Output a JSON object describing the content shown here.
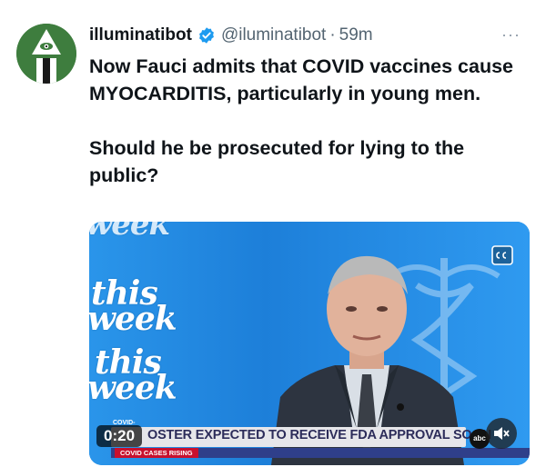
{
  "tweet": {
    "author": {
      "name": "illuminatibot",
      "handle": "@iluminatibot",
      "verified": true,
      "avatar_icon": "eye-pyramid-avatar-icon"
    },
    "separator": "·",
    "time": "59m",
    "more_label": "···",
    "paragraphs": [
      "Now Fauci admits that COVID vaccines cause MYOCARDITIS, particularly in young men.",
      "Should he be prosecuted for lying to the public?"
    ]
  },
  "video": {
    "timer": "0:20",
    "network_logo_lines": [
      "this",
      "week"
    ],
    "lower_third": {
      "tag": "COVID-",
      "headline": "OSTER EXPECTED TO RECEIVE FDA APPROVAL SOON",
      "sub_label": "COVID CASES RISING"
    },
    "network_badge": "abc",
    "icons": [
      "closed-captions-icon",
      "mute-icon"
    ]
  },
  "colors": {
    "verified_blue": "#1d9bf0",
    "video_blue": "#1f86e0",
    "text_primary": "#0f1419",
    "text_secondary": "#536471"
  }
}
